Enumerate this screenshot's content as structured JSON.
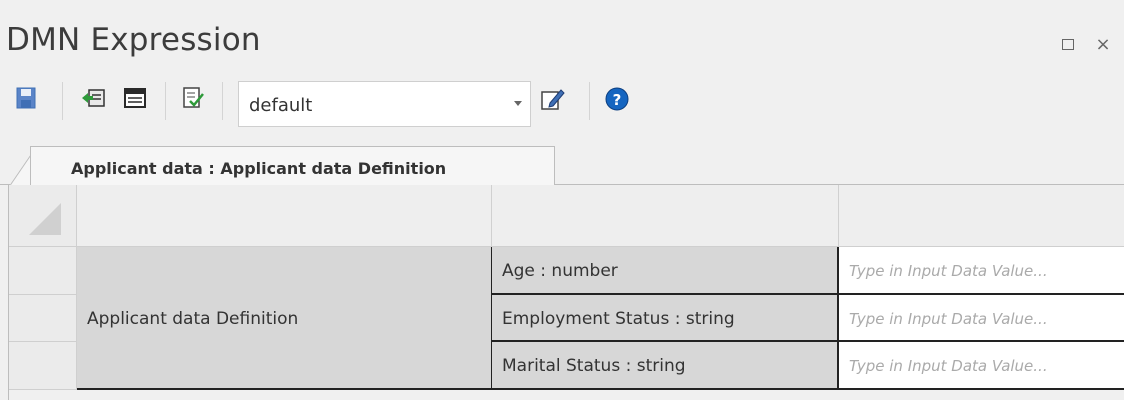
{
  "window": {
    "title": "DMN Expression",
    "restore_icon": "restore-icon",
    "close_glyph": "×"
  },
  "toolbar": {
    "buttons": [
      {
        "name": "save-icon",
        "interactable": true
      },
      {
        "name": "import-icon",
        "interactable": true
      },
      {
        "name": "table-icon",
        "interactable": true
      },
      {
        "name": "validate-icon",
        "interactable": true
      },
      {
        "name": "edit-icon",
        "interactable": true
      },
      {
        "name": "help-icon",
        "interactable": true
      }
    ],
    "configuration_select": {
      "value": "default",
      "options_visible": [
        "default"
      ]
    }
  },
  "tab": {
    "label": "Applicant data : Applicant data Definition"
  },
  "table": {
    "definition_name": "Applicant data Definition",
    "rows": [
      {
        "field": "Age : number",
        "value_placeholder": "Type in Input Data Value..."
      },
      {
        "field": "Employment Status : string",
        "value_placeholder": "Type in Input Data Value..."
      },
      {
        "field": "Marital Status : string",
        "value_placeholder": "Type in Input Data Value..."
      }
    ]
  },
  "colors": {
    "background": "#f0f0f0",
    "grid_cell": "#d7d7d7",
    "value_placeholder": "#aaaaaa",
    "help_icon": "#1565c0",
    "save_icon": "#3f6fb5"
  }
}
